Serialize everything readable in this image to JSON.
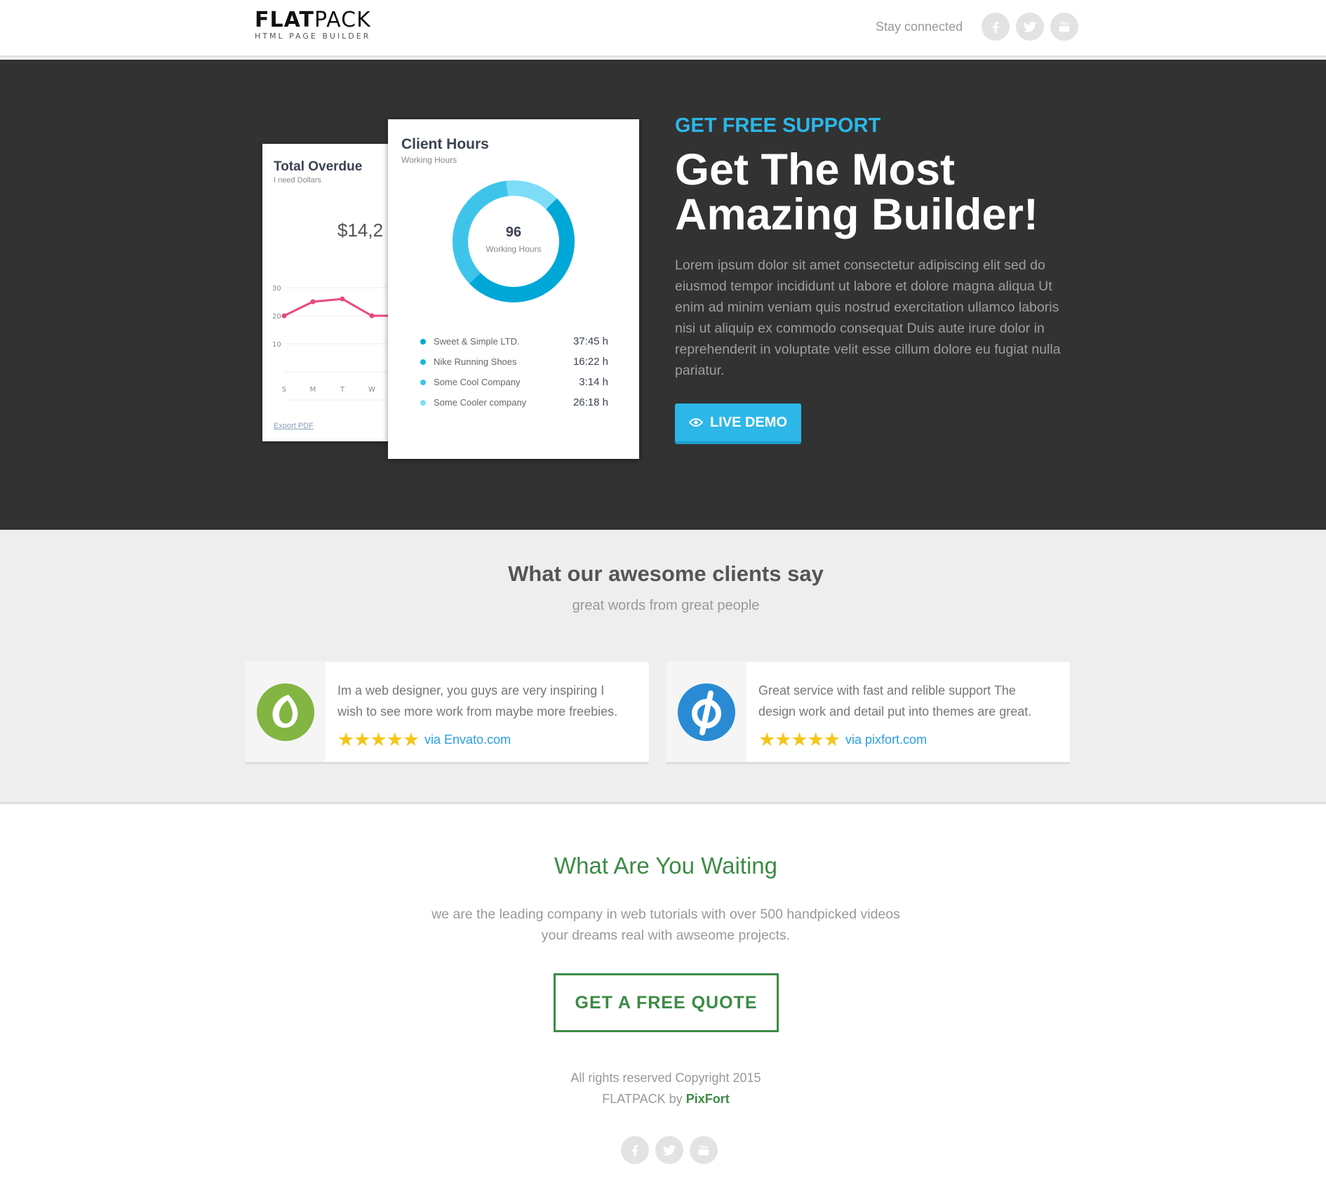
{
  "header": {
    "logo_bold": "FLAT",
    "logo_light": "PACK",
    "logo_tagline": "HTML PAGE BUILDER",
    "stay_connected": "Stay connected",
    "social": [
      "facebook-icon",
      "twitter-icon",
      "youtube-icon"
    ]
  },
  "hero": {
    "overdue_card": {
      "title": "Total Overdue",
      "subtitle": "I need Dollars",
      "amount": "$14,2",
      "y_ticks": [
        "30",
        "20",
        "10"
      ],
      "x_ticks": [
        "S",
        "M",
        "T",
        "W"
      ],
      "line_values": [
        20,
        25,
        26,
        20,
        20
      ],
      "line_color": "#e9497a",
      "export_link": "Export PDF"
    },
    "hours_card": {
      "title": "Client Hours",
      "subtitle": "Working Hours",
      "donut_value": "96",
      "donut_label": "Working Hours",
      "clients": [
        {
          "name": "Sweet & Simple LTD.",
          "hours": "37:45 h",
          "color": "#00a8d8"
        },
        {
          "name": "Nike Running Shoes",
          "hours": "16:22 h",
          "color": "#18b4e0"
        },
        {
          "name": "Some Cool Company",
          "hours": "3:14 h",
          "color": "#3ec4ea"
        },
        {
          "name": "Some Cooler company",
          "hours": "26:18 h",
          "color": "#7fdcf7"
        }
      ]
    },
    "kicker": "GET FREE SUPPORT",
    "headline": "Get The Most Amazing Builder!",
    "body": "Lorem ipsum dolor sit amet consectetur adipiscing elit sed do eiusmod tempor incididunt ut labore et dolore magna aliqua Ut enim ad minim veniam quis nostrud exercitation ullamco laboris nisi ut aliquip ex commodo consequat Duis aute irure dolor in reprehenderit in voluptate velit esse cillum dolore eu fugiat nulla pariatur.",
    "demo_button": "LIVE DEMO",
    "accent_color": "#2cb7e8"
  },
  "testimonials": {
    "title": "What our awesome clients say",
    "subtitle": "great words from great people",
    "items": [
      {
        "text": "Im a web designer, you guys are very inspiring I wish to see more work from maybe more freebies.",
        "stars": "★★★★★",
        "via": "via Envato.com",
        "logo": "envato-icon"
      },
      {
        "text": "Great service with fast and relible support The design work and detail put into themes are great.",
        "stars": "★★★★★",
        "via": "via pixfort.com",
        "logo": "pixfort-icon"
      }
    ]
  },
  "cta": {
    "title": "What Are You Waiting",
    "text": "we are the leading company in web tutorials with over 500 handpicked videos your dreams real with awseome projects.",
    "button": "GET A FREE QUOTE",
    "color": "#3c8b45"
  },
  "footer": {
    "copyright": "All rights reserved Copyright 2015",
    "credit_prefix": "FLATPACK by",
    "credit_name": "PixFort",
    "social": [
      "facebook-icon",
      "twitter-icon",
      "youtube-icon"
    ]
  }
}
